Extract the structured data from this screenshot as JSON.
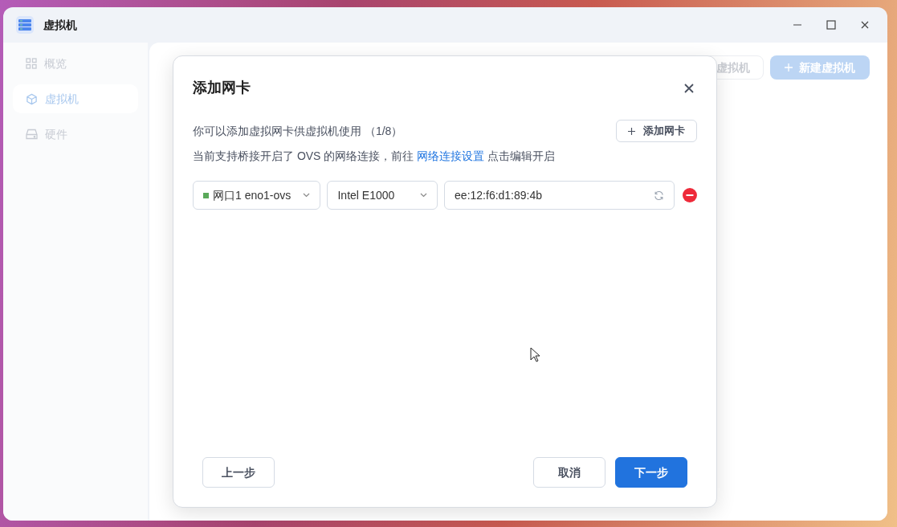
{
  "window": {
    "title": "虚拟机"
  },
  "sidebar": {
    "items": [
      {
        "label": "概览",
        "kind": "grid",
        "selected": false
      },
      {
        "label": "虚拟机",
        "kind": "cube",
        "selected": true
      },
      {
        "label": "硬件",
        "kind": "drive",
        "selected": false
      }
    ]
  },
  "main": {
    "buttons": [
      {
        "label": "虚拟机",
        "kind": "secondary"
      },
      {
        "label": "新建虚拟机",
        "kind": "primary"
      }
    ]
  },
  "dialog": {
    "title": "添加网卡",
    "info": "你可以添加虚拟网卡供虚拟机使用 （1/8）",
    "add_button": "添加网卡",
    "note": {
      "before": "当前支持桥接开启了 OVS 的网络连接，前往",
      "link": "网络连接设置",
      "after": "点击编辑开启"
    },
    "nics": [
      {
        "interface": "网口1 eno1-ovs",
        "color": "#5aa95a",
        "model": "Intel E1000",
        "mac": "ee:12:f6:d1:89:4b"
      }
    ],
    "buttons": [
      {
        "label": "上一步",
        "kind": "secondary"
      },
      {
        "label": "取消",
        "kind": "secondary"
      },
      {
        "label": "下一步",
        "kind": "primary"
      }
    ]
  }
}
